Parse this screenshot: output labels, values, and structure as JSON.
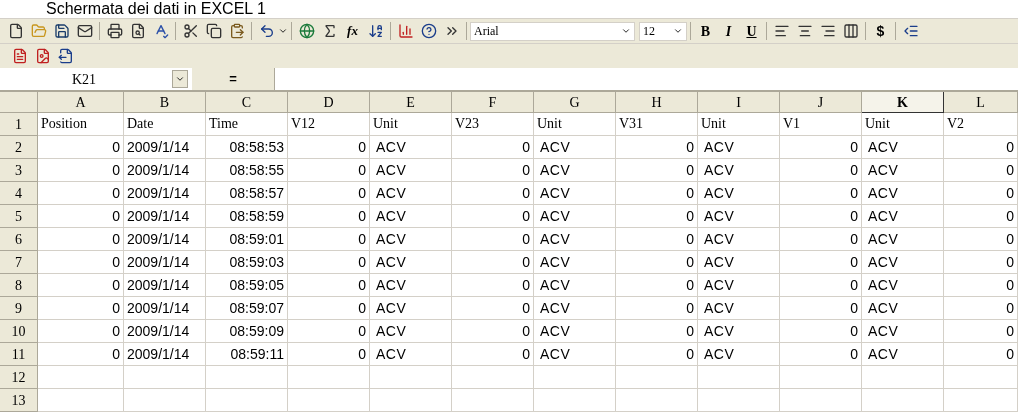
{
  "caption": "Schermata dei dati in EXCEL 1",
  "toolbar": {
    "font": "Arial",
    "size": "12",
    "fx": "fx",
    "format_buttons": [
      "B",
      "I",
      "U"
    ],
    "currency": "$"
  },
  "formula_bar": {
    "name_box": "K21",
    "equals": "="
  },
  "columns": [
    {
      "letter": "A",
      "kind": "number",
      "selected": false
    },
    {
      "letter": "B",
      "kind": "date",
      "selected": false
    },
    {
      "letter": "C",
      "kind": "number",
      "selected": false
    },
    {
      "letter": "D",
      "kind": "number",
      "selected": false
    },
    {
      "letter": "E",
      "kind": "text",
      "selected": false
    },
    {
      "letter": "F",
      "kind": "number",
      "selected": false
    },
    {
      "letter": "G",
      "kind": "text",
      "selected": false
    },
    {
      "letter": "H",
      "kind": "number",
      "selected": false
    },
    {
      "letter": "I",
      "kind": "text",
      "selected": false
    },
    {
      "letter": "J",
      "kind": "number",
      "selected": false
    },
    {
      "letter": "K",
      "kind": "text",
      "selected": true
    },
    {
      "letter": "L",
      "kind": "number",
      "selected": false
    }
  ],
  "rows": [
    {
      "number": "1",
      "cells": [
        "Position",
        "Date",
        "Time",
        "V12",
        "Unit",
        "V23",
        "Unit",
        "V31",
        "Unit",
        "V1",
        "Unit",
        "V2"
      ]
    },
    {
      "number": "2",
      "cells": [
        "0",
        "2009/1/14",
        "08:58:53",
        "0",
        "ACV",
        "0",
        "ACV",
        "0",
        "ACV",
        "0",
        "ACV",
        "0"
      ]
    },
    {
      "number": "3",
      "cells": [
        "0",
        "2009/1/14",
        "08:58:55",
        "0",
        "ACV",
        "0",
        "ACV",
        "0",
        "ACV",
        "0",
        "ACV",
        "0"
      ]
    },
    {
      "number": "4",
      "cells": [
        "0",
        "2009/1/14",
        "08:58:57",
        "0",
        "ACV",
        "0",
        "ACV",
        "0",
        "ACV",
        "0",
        "ACV",
        "0"
      ]
    },
    {
      "number": "5",
      "cells": [
        "0",
        "2009/1/14",
        "08:58:59",
        "0",
        "ACV",
        "0",
        "ACV",
        "0",
        "ACV",
        "0",
        "ACV",
        "0"
      ]
    },
    {
      "number": "6",
      "cells": [
        "0",
        "2009/1/14",
        "08:59:01",
        "0",
        "ACV",
        "0",
        "ACV",
        "0",
        "ACV",
        "0",
        "ACV",
        "0"
      ]
    },
    {
      "number": "7",
      "cells": [
        "0",
        "2009/1/14",
        "08:59:03",
        "0",
        "ACV",
        "0",
        "ACV",
        "0",
        "ACV",
        "0",
        "ACV",
        "0"
      ]
    },
    {
      "number": "8",
      "cells": [
        "0",
        "2009/1/14",
        "08:59:05",
        "0",
        "ACV",
        "0",
        "ACV",
        "0",
        "ACV",
        "0",
        "ACV",
        "0"
      ]
    },
    {
      "number": "9",
      "cells": [
        "0",
        "2009/1/14",
        "08:59:07",
        "0",
        "ACV",
        "0",
        "ACV",
        "0",
        "ACV",
        "0",
        "ACV",
        "0"
      ]
    },
    {
      "number": "10",
      "cells": [
        "0",
        "2009/1/14",
        "08:59:09",
        "0",
        "ACV",
        "0",
        "ACV",
        "0",
        "ACV",
        "0",
        "ACV",
        "0"
      ]
    },
    {
      "number": "11",
      "cells": [
        "0",
        "2009/1/14",
        "08:59:11",
        "0",
        "ACV",
        "0",
        "ACV",
        "0",
        "ACV",
        "0",
        "ACV",
        "0"
      ]
    },
    {
      "number": "12",
      "cells": []
    },
    {
      "number": "13",
      "cells": []
    }
  ]
}
